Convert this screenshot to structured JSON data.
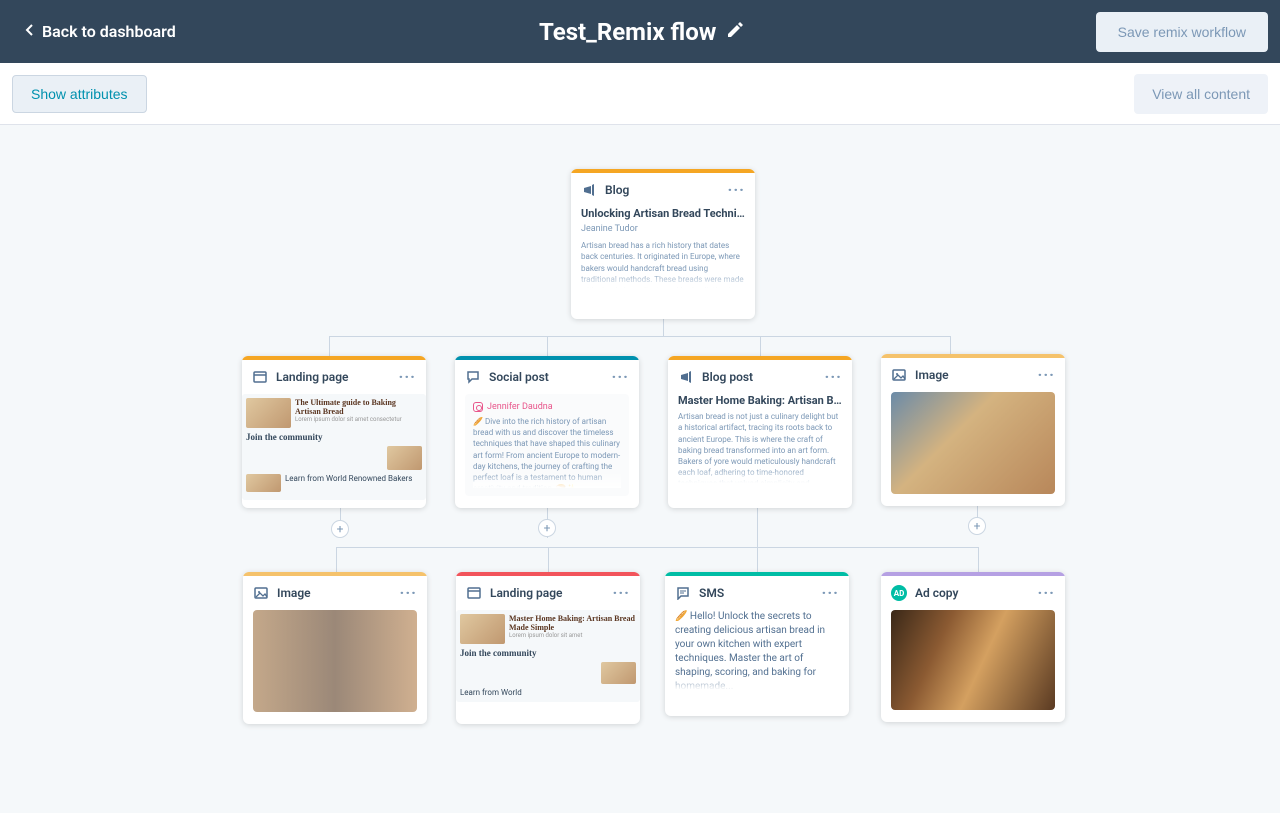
{
  "header": {
    "back_label": "Back to dashboard",
    "title": "Test_Remix flow",
    "save_label": "Save remix workflow"
  },
  "subheader": {
    "show_attributes_label": "Show attributes",
    "view_all_label": "View all content"
  },
  "colors": {
    "orange": "#f5a623",
    "blue": "#0091ae",
    "yellow": "#f5c26b",
    "green": "#00bda5",
    "purple": "#b5a0e3",
    "red_orange": "#f2545b"
  },
  "nodes": {
    "root": {
      "type": "Blog",
      "title": "Unlocking Artisan Bread Technique...",
      "author": "Jeanine Tudor",
      "text": "Artisan bread has a rich history that dates back centuries. It originated in Europe, where bakers would handcraft bread using traditional methods. These breads were made with simple ingredients and had a distinctive taste and texture. Over time...",
      "stripe": "#f5a623"
    },
    "row1": [
      {
        "type": "Landing page",
        "stripe": "#f5a623",
        "preview_title": "The Ultimate guide to Baking Artisan Bread",
        "community": "Join the community",
        "learn": "Learn from World Renowned Bakers"
      },
      {
        "type": "Social post",
        "stripe": "#0091ae",
        "social_author": "Jennifer Daudna",
        "text": "🥖 Dive into the rich history of artisan bread with us and discover the timeless techniques that have shaped this culinary art form! From ancient Europe to modern-day kitchens, the journey of crafting the perfect loaf is a testament to human creativity and tradition. 🍞✨ #ArtisanBread #BakingHistory #CulinaryTraditions"
      },
      {
        "type": "Blog post",
        "stripe": "#f5a623",
        "title": "Master Home Baking: Artisan Ba..",
        "text": "Artisan bread is not just a culinary delight but a historical artifact, tracing its roots back to ancient Europe. This is where the craft of baking bread transformed into an art form. Bakers of yore would meticulously handcraft each loaf, adhering to time-honored techniques that valued simplicity and..."
      },
      {
        "type": "Image",
        "stripe": "#f5c26b"
      }
    ],
    "row2": [
      {
        "type": "Image",
        "stripe": "#f5c26b"
      },
      {
        "type": "Landing page",
        "stripe": "#f2545b",
        "preview_title": "Master Home Baking: Artisan Bread Made Simple",
        "community": "Join the community",
        "learn": "Learn from World"
      },
      {
        "type": "SMS",
        "stripe": "#00bda5",
        "text": "🥖 Hello! Unlock the secrets to creating delicious artisan bread in your own kitchen with expert techniques. Master the art of shaping, scoring, and baking for homemade..."
      },
      {
        "type": "Ad copy",
        "stripe": "#b5a0e3",
        "badge": "AD"
      }
    ]
  }
}
